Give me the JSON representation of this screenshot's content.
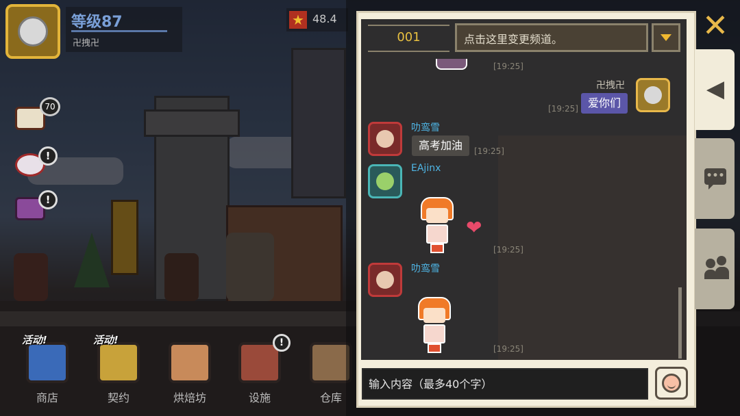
{
  "hud": {
    "player_level": "等级87",
    "player_name": "卍拽卍",
    "star_value": "48.4"
  },
  "side_icons": {
    "mail_count": "70",
    "alert_mark": "!"
  },
  "bottom_nav": [
    {
      "label": "商店",
      "promo": "活动!",
      "icon": "shop-icon"
    },
    {
      "label": "契约",
      "promo": "活动!",
      "icon": "contract-icon"
    },
    {
      "label": "烘焙坊",
      "promo": "",
      "icon": "bakery-icon"
    },
    {
      "label": "设施",
      "promo": "",
      "alert": "!",
      "icon": "facility-icon"
    },
    {
      "label": "仓库",
      "promo": "",
      "icon": "warehouse-icon"
    }
  ],
  "chat": {
    "channel_number": "001",
    "channel_change_text": "点击这里变更频道。",
    "messages": [
      {
        "type": "partial-sticker",
        "time": "[19:25]"
      },
      {
        "type": "text",
        "self": true,
        "user": "卍拽卍",
        "text": "爱你们",
        "time": "[19:25]"
      },
      {
        "type": "text",
        "self": false,
        "user": "叻鸾雪",
        "text": "高考加油",
        "time": "[19:25]"
      },
      {
        "type": "sticker",
        "self": false,
        "user": "EAjinx",
        "time": "[19:25]"
      },
      {
        "type": "sticker",
        "self": false,
        "user": "叻鸾雪",
        "time": "[19:25]"
      }
    ],
    "input_placeholder": "输入内容（最多40个字）",
    "close_symbol": "✕"
  },
  "colors": {
    "panel_bg": "#f4eedc",
    "chat_bg": "#1e1e20",
    "username_other": "#4fb6e6",
    "bubble_self": "#5b56a8",
    "bubble_other": "#4d4a46",
    "accent_gold": "#e8b84a"
  }
}
